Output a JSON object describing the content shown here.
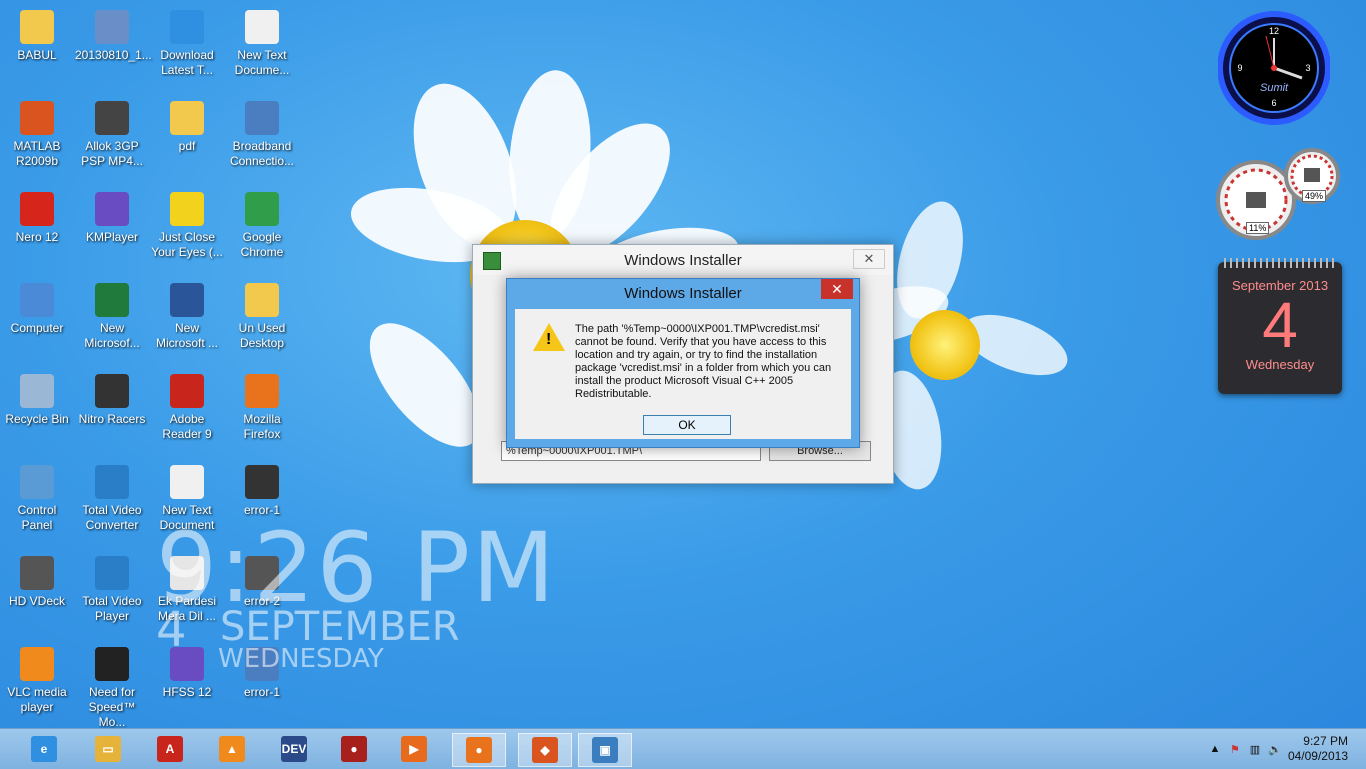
{
  "desktop_icons": [
    {
      "label": "BABUL",
      "glyph": "folder-icon",
      "color": "#f2c94c"
    },
    {
      "label": "20130810_1...",
      "glyph": "photo-icon",
      "color": "#6a8fc8"
    },
    {
      "label": "Download\nLatest T...",
      "glyph": "ie-icon",
      "color": "#2f8fe0"
    },
    {
      "label": "New Text\nDocume...",
      "glyph": "text-file-icon",
      "color": "#f0f0f0"
    },
    {
      "label": "MATLAB\nR2009b",
      "glyph": "matlab-icon",
      "color": "#d9541e"
    },
    {
      "label": "Allok 3GP\nPSP MP4...",
      "glyph": "film-icon",
      "color": "#444"
    },
    {
      "label": "pdf",
      "glyph": "folder-icon",
      "color": "#f2c94c"
    },
    {
      "label": "Broadband\nConnectio...",
      "glyph": "network-icon",
      "color": "#4a7ec0"
    },
    {
      "label": "Nero 12",
      "glyph": "nero-icon",
      "color": "#d6261c"
    },
    {
      "label": "KMPlayer",
      "glyph": "kmplayer-icon",
      "color": "#6a4cc2"
    },
    {
      "label": "Just Close\nYour Eyes (...",
      "glyph": "mp3-art-icon",
      "color": "#f2d21c"
    },
    {
      "label": "Google\nChrome",
      "glyph": "chrome-icon",
      "color": "#2f9d4a"
    },
    {
      "label": "Computer",
      "glyph": "computer-icon",
      "color": "#4a8ad6"
    },
    {
      "label": "New\nMicrosof...",
      "glyph": "excel-icon",
      "color": "#1f7a3c"
    },
    {
      "label": "New\nMicrosoft ...",
      "glyph": "word-icon",
      "color": "#2a5699"
    },
    {
      "label": "Un Used\nDesktop",
      "glyph": "folder-icon",
      "color": "#f2c94c"
    },
    {
      "label": "Recycle Bin",
      "glyph": "recycle-bin-icon",
      "color": "#9bb7d6"
    },
    {
      "label": "Nitro Racers",
      "glyph": "game-icon",
      "color": "#333"
    },
    {
      "label": "Adobe\nReader 9",
      "glyph": "pdf-icon",
      "color": "#c8261c"
    },
    {
      "label": "Mozilla\nFirefox",
      "glyph": "firefox-icon",
      "color": "#e8731c"
    },
    {
      "label": "Control\nPanel",
      "glyph": "control-panel-icon",
      "color": "#5a9bd6"
    },
    {
      "label": "Total Video\nConverter",
      "glyph": "converter-icon",
      "color": "#2a7ec8"
    },
    {
      "label": "New Text\nDocument",
      "glyph": "text-file-icon",
      "color": "#f0f0f0"
    },
    {
      "label": "error-1",
      "glyph": "image-icon",
      "color": "#333"
    },
    {
      "label": "HD VDeck",
      "glyph": "media-icon",
      "color": "#555"
    },
    {
      "label": "Total Video\nPlayer",
      "glyph": "play-icon",
      "color": "#2a7ec8"
    },
    {
      "label": "Ek Pardesi\nMera Dil ...",
      "glyph": "mp3-file-icon",
      "color": "#e6e6e6"
    },
    {
      "label": "error-2",
      "glyph": "image-icon",
      "color": "#555"
    },
    {
      "label": "VLC media\nplayer",
      "glyph": "vlc-icon",
      "color": "#f08a1c"
    },
    {
      "label": "Need for\nSpeed™ Mo...",
      "glyph": "nfs-icon",
      "color": "#222"
    },
    {
      "label": "HFSS 12",
      "glyph": "hfss-icon",
      "color": "#6a4cc2"
    },
    {
      "label": "error-1",
      "glyph": "image-icon",
      "color": "#4a7ec0"
    }
  ],
  "overlay_clock": {
    "time": "9:26 PM",
    "day": "4",
    "month": "SEPTEMBER",
    "weekday": "WEDNESDAY"
  },
  "clock_gadget": {
    "name": "Sumit"
  },
  "meter_gadget": {
    "cpu": "11%",
    "memory": "49%"
  },
  "calendar_gadget": {
    "month": "September 2013",
    "day": "4",
    "weekday": "Wednesday"
  },
  "installer_back": {
    "title": "Windows Installer",
    "close_label": "✕",
    "path_value": "%Temp~0000\\IXP001.TMP\\",
    "browse_label": "Browse..."
  },
  "installer_error": {
    "title": "Windows Installer",
    "close_label": "✕",
    "message": "The path '%Temp~0000\\IXP001.TMP\\vcredist.msi' cannot be found. Verify that you have access to this location and try again, or try to find the installation package 'vcredist.msi' in a folder from which you can install the product Microsoft Visual C++ 2005 Redistributable.",
    "ok_label": "OK"
  },
  "taskbar": {
    "items": [
      {
        "name": "ie",
        "glyph": "ie-icon",
        "color": "#2f8fe0",
        "text": "e"
      },
      {
        "name": "explorer",
        "glyph": "folder-icon",
        "color": "#e6b33a",
        "text": "▭"
      },
      {
        "name": "adobe-reader",
        "glyph": "pdf-icon",
        "color": "#c8261c",
        "text": "A"
      },
      {
        "name": "vlc",
        "glyph": "vlc-icon",
        "color": "#f08a1c",
        "text": "▲"
      },
      {
        "name": "devcpp",
        "glyph": "devcpp-icon",
        "color": "#2a4a8a",
        "text": "DEV"
      },
      {
        "name": "cricket",
        "glyph": "ball-icon",
        "color": "#a8201c",
        "text": "●"
      },
      {
        "name": "video-player",
        "glyph": "play-icon",
        "color": "#e86a1c",
        "text": "▶"
      },
      {
        "name": "firefox",
        "glyph": "firefox-icon",
        "color": "#e8731c",
        "text": "●"
      },
      {
        "name": "matlab",
        "glyph": "matlab-icon",
        "color": "#d9541e",
        "text": "◆"
      },
      {
        "name": "installer",
        "glyph": "installer-icon",
        "color": "#3a7ec0",
        "text": "▣"
      }
    ],
    "tray_time": "9:27 PM",
    "tray_date": "04/09/2013"
  }
}
